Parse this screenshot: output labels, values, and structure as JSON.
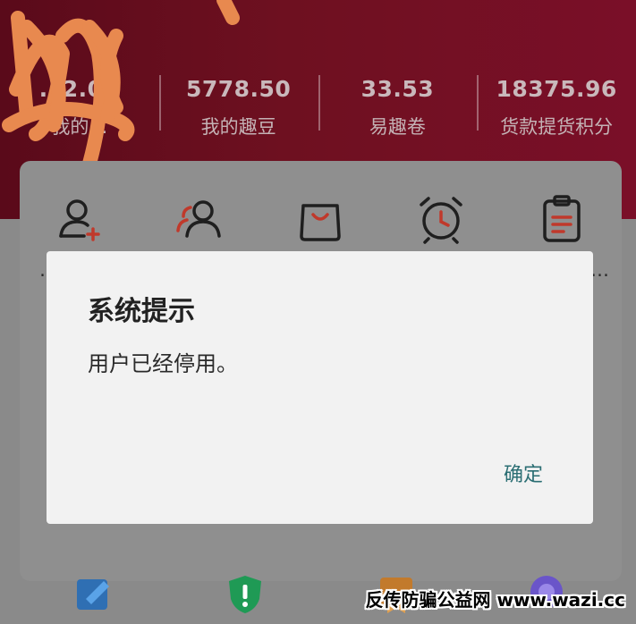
{
  "stats": [
    {
      "value": "5778.50",
      "label": "我的趣豆"
    },
    {
      "value": "33.53",
      "label": "易趣卷"
    },
    {
      "value": "18375.96",
      "label": "货款提货积分"
    }
  ],
  "partial_stat": {
    "value": "…2.00",
    "label": "我的…"
  },
  "icons": [
    "add-user-icon",
    "team-icon",
    "shopping-bag-icon",
    "alarm-clock-icon",
    "clipboard-icon"
  ],
  "dialog": {
    "title": "系统提示",
    "message": "用户已经停用。",
    "confirm_label": "确定"
  },
  "watermark": "反传防骗公益网 www.wazi.cc",
  "colors": {
    "header": "#6e1020",
    "dialog_bg": "#f2f2f2",
    "accent": "#2b6e73",
    "icon_red": "#c0392b"
  }
}
